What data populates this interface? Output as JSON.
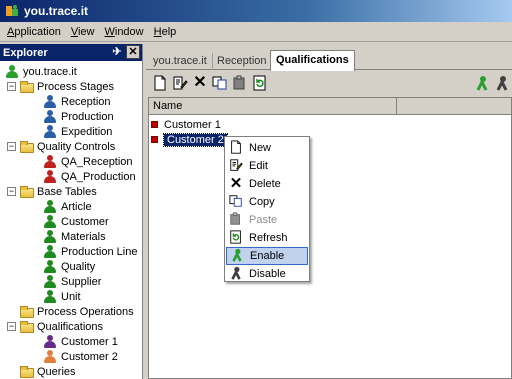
{
  "window": {
    "title": "you.trace.it"
  },
  "menu": [
    {
      "label": "Application",
      "u": "A"
    },
    {
      "label": "View",
      "u": "V"
    },
    {
      "label": "Window",
      "u": "W"
    },
    {
      "label": "Help",
      "u": "H"
    }
  ],
  "explorer": {
    "title": "Explorer",
    "pin": "✈",
    "close": "✕",
    "root": "you.trace.it",
    "groups": [
      {
        "label": "Process Stages",
        "children": [
          "Reception",
          "Production",
          "Expedition"
        ]
      },
      {
        "label": "Quality Controls",
        "children": [
          "QA_Reception",
          "QA_Production"
        ]
      },
      {
        "label": "Base Tables",
        "children": [
          "Article",
          "Customer",
          "Materials",
          "Production Line",
          "Quality",
          "Supplier",
          "Unit"
        ]
      },
      {
        "label": "Process Operations",
        "children": []
      },
      {
        "label": "Qualifications",
        "children": [
          "Customer 1",
          "Customer 2"
        ]
      },
      {
        "label": "Queries",
        "children": []
      }
    ]
  },
  "tabs": [
    {
      "label": "you.trace.it",
      "active": false
    },
    {
      "label": "Reception",
      "active": false
    },
    {
      "label": "Qualifications",
      "active": true
    }
  ],
  "grid": {
    "column": "Name",
    "rows": [
      {
        "label": "Customer 1",
        "selected": false
      },
      {
        "label": "Customer 2",
        "selected": true
      }
    ]
  },
  "context_menu": {
    "items": [
      {
        "label": "New",
        "icon": "new-icon",
        "disabled": false
      },
      {
        "label": "Edit",
        "icon": "edit-icon",
        "disabled": false
      },
      {
        "label": "Delete",
        "icon": "delete-icon",
        "disabled": false
      },
      {
        "label": "Copy",
        "icon": "copy-icon",
        "disabled": false
      },
      {
        "label": "Paste",
        "icon": "paste-icon",
        "disabled": true
      },
      {
        "label": "Refresh",
        "icon": "refresh-icon",
        "disabled": false
      },
      {
        "label": "Enable",
        "icon": "enable-icon",
        "disabled": false,
        "hover": true
      },
      {
        "label": "Disable",
        "icon": "disable-icon",
        "disabled": false
      }
    ]
  },
  "colors": {
    "titlebar": "#0a246a",
    "tree_person": "#1f8a1f",
    "tree_person_blue": "#2a5fa8",
    "status_red": "#c00000",
    "hover": "#c1d2ee"
  }
}
